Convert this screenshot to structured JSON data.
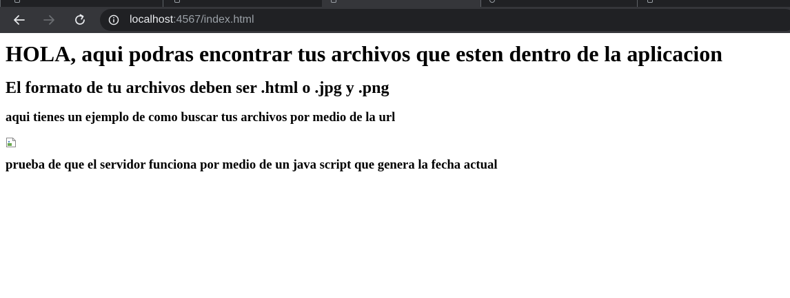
{
  "browser": {
    "url_host": "localhost",
    "url_path": ":4567/index.html"
  },
  "page": {
    "heading1": "HOLA, aqui podras encontrar tus archivos que esten dentro de la aplicacion",
    "heading2": "El formato de tu archivos deben ser .html o .jpg y .png",
    "heading3": "aqui tienes un ejemplo de como buscar tus archivos por medio de la url",
    "image_icon": "broken-image-icon",
    "heading4": "prueba de que el servidor funciona por medio de un java script que genera la fecha actual"
  },
  "colors": {
    "chrome_bg": "#35363a",
    "tabstrip_bg": "#202124",
    "omnibox_bg": "#202124",
    "url_host": "#e8eaed",
    "url_rest": "#9aa0a6"
  }
}
